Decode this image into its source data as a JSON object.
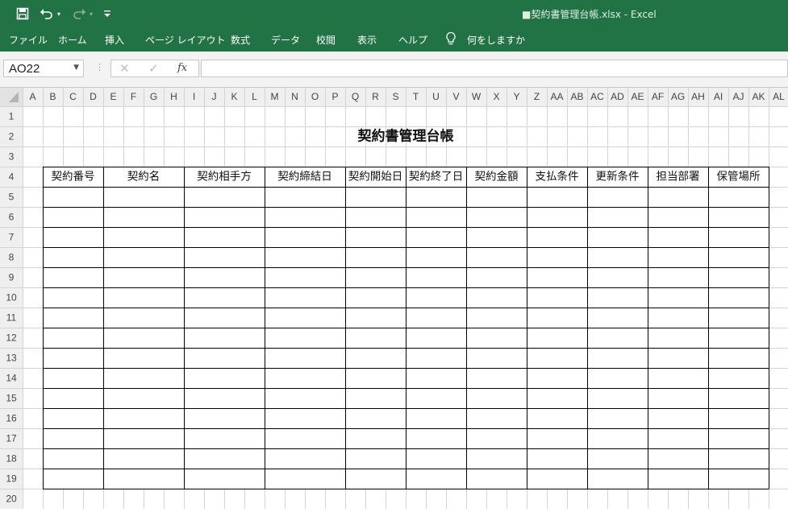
{
  "app": {
    "doc_title": "■契約書管理台帳.xlsx  -  Excel",
    "accent": "#217346"
  },
  "qat": {
    "save_icon": "save-icon",
    "undo_icon": "undo-icon",
    "redo_icon": "redo-icon",
    "customize_icon": "customize-qat-icon"
  },
  "ribbon": {
    "tabs": [
      "ファイル",
      "ホーム",
      "挿入",
      "ページ レイアウト",
      "数式",
      "データ",
      "校閲",
      "表示",
      "ヘルプ"
    ],
    "tell_me": "何をしますか"
  },
  "formula_bar": {
    "name_box": "AO22",
    "fx_label": "fx",
    "formula": ""
  },
  "sheet": {
    "columns": [
      "A",
      "B",
      "C",
      "D",
      "E",
      "F",
      "G",
      "H",
      "I",
      "J",
      "K",
      "L",
      "M",
      "N",
      "O",
      "P",
      "Q",
      "R",
      "S",
      "T",
      "U",
      "V",
      "W",
      "X",
      "Y",
      "Z",
      "AA",
      "AB",
      "AC",
      "AD",
      "AE",
      "AF",
      "AG",
      "AH",
      "AI",
      "AJ",
      "AK",
      "AL"
    ],
    "rows": [
      "1",
      "2",
      "3",
      "4",
      "5",
      "6",
      "7",
      "8",
      "9",
      "10",
      "11",
      "12",
      "13",
      "14",
      "15",
      "16",
      "17",
      "18",
      "19",
      "20"
    ],
    "title": "契約書管理台帳",
    "table_headers": [
      "契約番号",
      "契約名",
      "契約相手方",
      "契約締結日",
      "契約開始日",
      "契約終了日",
      "契約金額",
      "支払条件",
      "更新条件",
      "担当部署",
      "保管場所"
    ],
    "table_data_rows": 15
  }
}
